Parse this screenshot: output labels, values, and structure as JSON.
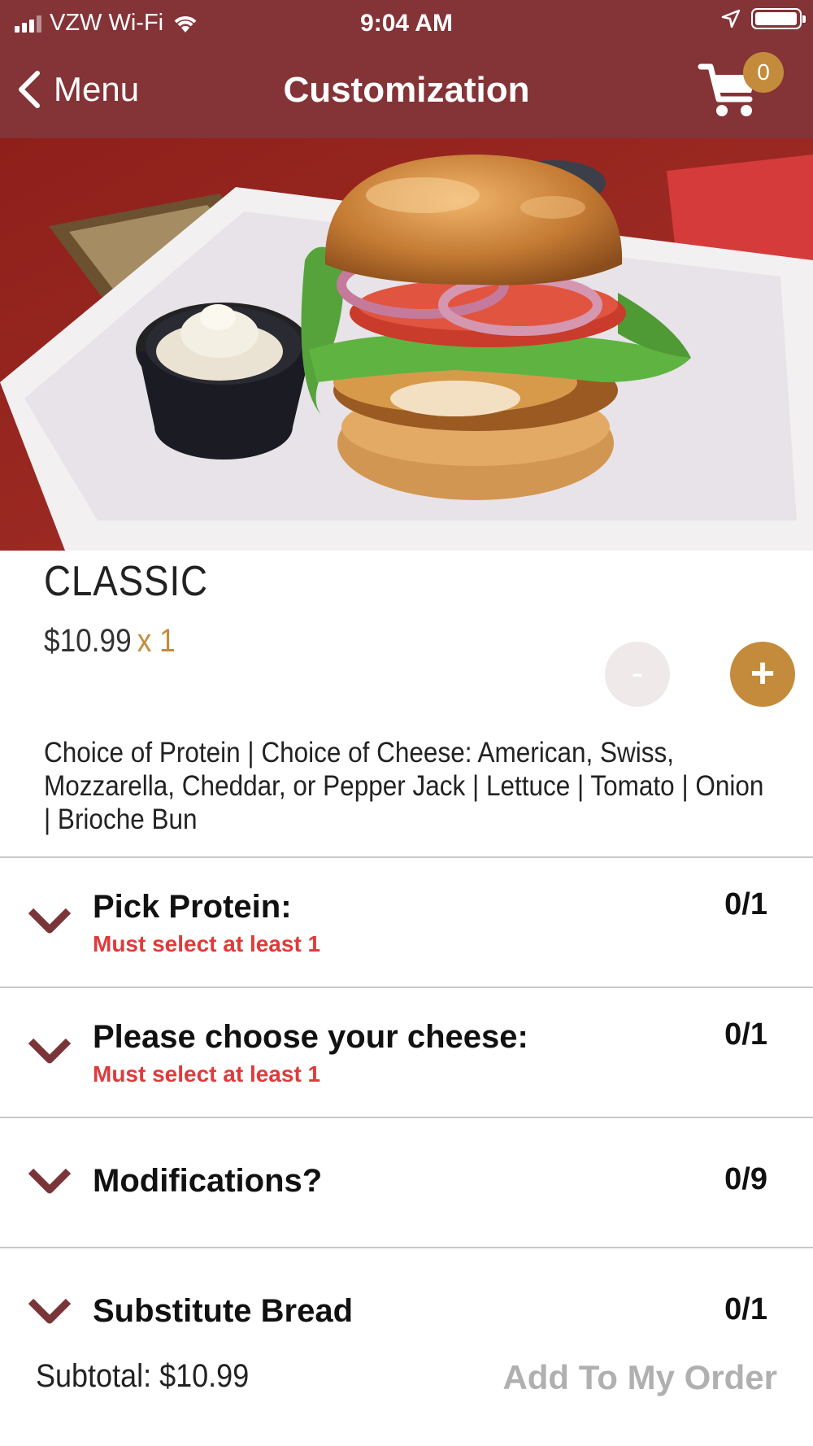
{
  "status_bar": {
    "carrier": "VZW Wi-Fi",
    "time": "9:04 AM",
    "icons": [
      "signal-icon",
      "wifi-icon",
      "location-arrow-icon",
      "battery-icon"
    ]
  },
  "nav": {
    "back_label": "Menu",
    "title": "Customization",
    "cart_count": "0"
  },
  "colors": {
    "brand": "#843337",
    "accent": "#c48b3c",
    "required": "#e03a3a",
    "disabled": "#b0b0b0"
  },
  "item": {
    "name": "CLASSIC",
    "price": "$10.99",
    "quantity": "x 1",
    "minus_label": "-",
    "plus_label": "+",
    "description": "Choice of Protein | Choice of Cheese: American, Swiss, Mozzarella, Cheddar,  or Pepper Jack | Lettuce | Tomato | Onion | Brioche Bun"
  },
  "groups": [
    {
      "title": "Pick Protein:",
      "requirement": "Must select at least 1",
      "count": "0/1"
    },
    {
      "title": "Please choose your cheese:",
      "requirement": "Must select at least 1",
      "count": "0/1"
    },
    {
      "title": "Modifications?",
      "requirement": "",
      "count": "0/9"
    },
    {
      "title": "Substitute Bread",
      "requirement": "",
      "count": "0/1"
    }
  ],
  "footer": {
    "subtotal": "Subtotal: $10.99",
    "add_button": "Add To My Order"
  }
}
